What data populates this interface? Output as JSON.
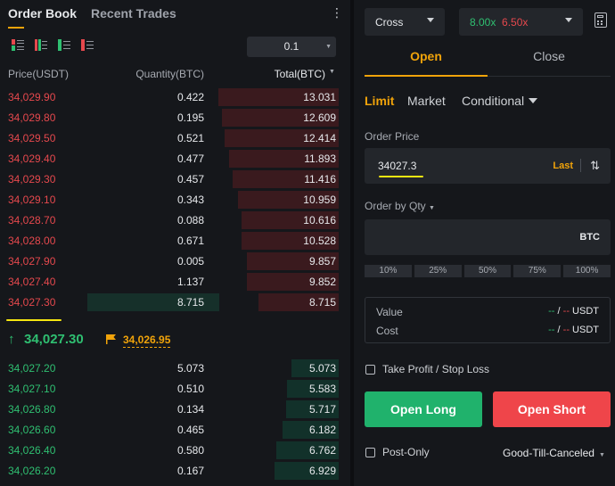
{
  "orderbook": {
    "tabs": [
      {
        "label": "Order Book",
        "active": true
      },
      {
        "label": "Recent Trades",
        "active": false
      }
    ],
    "precision": "0.1",
    "columns": {
      "price": "Price(USDT)",
      "quantity": "Quantity(BTC)",
      "total": "Total(BTC)"
    },
    "asks": [
      {
        "price": "34,029.90",
        "qty": "0.422",
        "total": "13.031",
        "depth": 1.0
      },
      {
        "price": "34,029.80",
        "qty": "0.195",
        "total": "12.609",
        "depth": 0.97
      },
      {
        "price": "34,029.50",
        "qty": "0.521",
        "total": "12.414",
        "depth": 0.95
      },
      {
        "price": "34,029.40",
        "qty": "0.477",
        "total": "11.893",
        "depth": 0.91
      },
      {
        "price": "34,029.30",
        "qty": "0.457",
        "total": "11.416",
        "depth": 0.88
      },
      {
        "price": "34,029.10",
        "qty": "0.343",
        "total": "10.959",
        "depth": 0.84
      },
      {
        "price": "34,028.70",
        "qty": "0.088",
        "total": "10.616",
        "depth": 0.81
      },
      {
        "price": "34,028.00",
        "qty": "0.671",
        "total": "10.528",
        "depth": 0.81
      },
      {
        "price": "34,027.90",
        "qty": "0.005",
        "total": "9.857",
        "depth": 0.76
      },
      {
        "price": "34,027.40",
        "qty": "1.137",
        "total": "9.852",
        "depth": 0.76
      },
      {
        "price": "34,027.30",
        "qty": "8.715",
        "total": "8.715",
        "depth": 0.67,
        "highlight": true
      }
    ],
    "last_price": "34,027.30",
    "mark_price": "34,026.95",
    "bids": [
      {
        "price": "34,027.20",
        "qty": "5.073",
        "total": "5.073",
        "depth": 0.39
      },
      {
        "price": "34,027.10",
        "qty": "0.510",
        "total": "5.583",
        "depth": 0.43
      },
      {
        "price": "34,026.80",
        "qty": "0.134",
        "total": "5.717",
        "depth": 0.44
      },
      {
        "price": "34,026.60",
        "qty": "0.465",
        "total": "6.182",
        "depth": 0.47
      },
      {
        "price": "34,026.40",
        "qty": "0.580",
        "total": "6.762",
        "depth": 0.52
      },
      {
        "price": "34,026.20",
        "qty": "0.167",
        "total": "6.929",
        "depth": 0.53
      }
    ]
  },
  "trade": {
    "margin_mode": "Cross",
    "leverage_long": "8.00x",
    "leverage_short": "6.50x",
    "tabs": {
      "open": "Open",
      "close": "Close"
    },
    "order_types": {
      "limit": "Limit",
      "market": "Market",
      "conditional": "Conditional"
    },
    "order_price_label": "Order Price",
    "order_price_value": "34027.3",
    "last_button": "Last",
    "qty_label": "Order by Qty",
    "qty_unit": "BTC",
    "percentages": [
      "10%",
      "25%",
      "50%",
      "75%",
      "100%"
    ],
    "value_label": "Value",
    "cost_label": "Cost",
    "placeholder_g": "--",
    "slash": "/",
    "placeholder_r": "--",
    "currency": "USDT",
    "tpsl_label": "Take Profit / Stop Loss",
    "open_long": "Open Long",
    "open_short": "Open Short",
    "post_only": "Post-Only",
    "time_in_force": "Good-Till-Canceled"
  },
  "colors": {
    "ask": "#e5484d",
    "bid": "#2fbf71",
    "accent": "#f0a30a",
    "highlight": "#f5e611"
  }
}
